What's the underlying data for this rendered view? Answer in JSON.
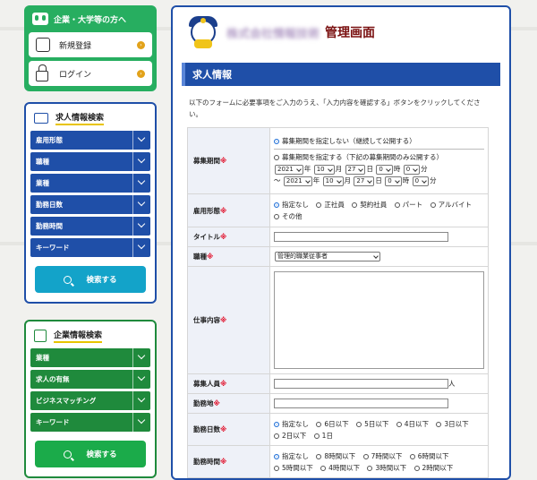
{
  "company_panel": {
    "title": "企業・大学等の方へ",
    "register_label": "新規登録",
    "login_label": "ログイン",
    "arrow": "›"
  },
  "job_search": {
    "title": "求人情報検索",
    "items": [
      "雇用形態",
      "職種",
      "業種",
      "勤務日数",
      "勤務時間",
      "キーワード"
    ],
    "button": "検索する"
  },
  "company_search": {
    "title": "企業情報検索",
    "items": [
      "業種",
      "求人の有無",
      "ビジネスマッチング",
      "キーワード"
    ],
    "button": "検索する"
  },
  "header": {
    "company_blurred": "株式会社情報技術",
    "title": "管理画面"
  },
  "section_title": "求人情報",
  "intro": "以下のフォームに必要事項をご入力のうえ、「入力内容を確認する」ボタンをクリックしてください。",
  "req_mark": "※",
  "form": {
    "period": {
      "label": "募集期間",
      "opt1": "募集期間を指定しない（継続して公開する）",
      "opt2": "募集期間を指定する（下記の募集期間のみ公開する）",
      "from": {
        "year": "2021",
        "month": "10",
        "day": "27",
        "hour": "0",
        "min": "0"
      },
      "to": {
        "year": "2021",
        "month": "10",
        "day": "27",
        "hour": "0",
        "min": "0"
      },
      "u_year": "年",
      "u_month": "月",
      "u_day": "日",
      "u_hour": "時",
      "u_min": "分",
      "tilde": "〜"
    },
    "employment": {
      "label": "雇用形態",
      "options": [
        "指定なし",
        "正社員",
        "契約社員",
        "パート",
        "アルバイト",
        "その他"
      ]
    },
    "title": {
      "label": "タイトル"
    },
    "occupation": {
      "label": "職種",
      "value": "管理的職業従事者"
    },
    "content": {
      "label": "仕事内容"
    },
    "headcount": {
      "label": "募集人員",
      "unit": "人"
    },
    "location": {
      "label": "勤務地"
    },
    "days": {
      "label": "勤務日数",
      "options": [
        "指定なし",
        "6日以下",
        "5日以下",
        "4日以下",
        "3日以下",
        "2日以下",
        "1日"
      ]
    },
    "hours": {
      "label": "勤務時間",
      "options": [
        "指定なし",
        "8時間以下",
        "7時間以下",
        "6時間以下",
        "5時間以下",
        "4時間以下",
        "3時間以下",
        "2時間以下"
      ]
    }
  },
  "colors": {
    "primary": "#1f4fa8",
    "green": "#27ae60",
    "accent": "#7a1010"
  }
}
